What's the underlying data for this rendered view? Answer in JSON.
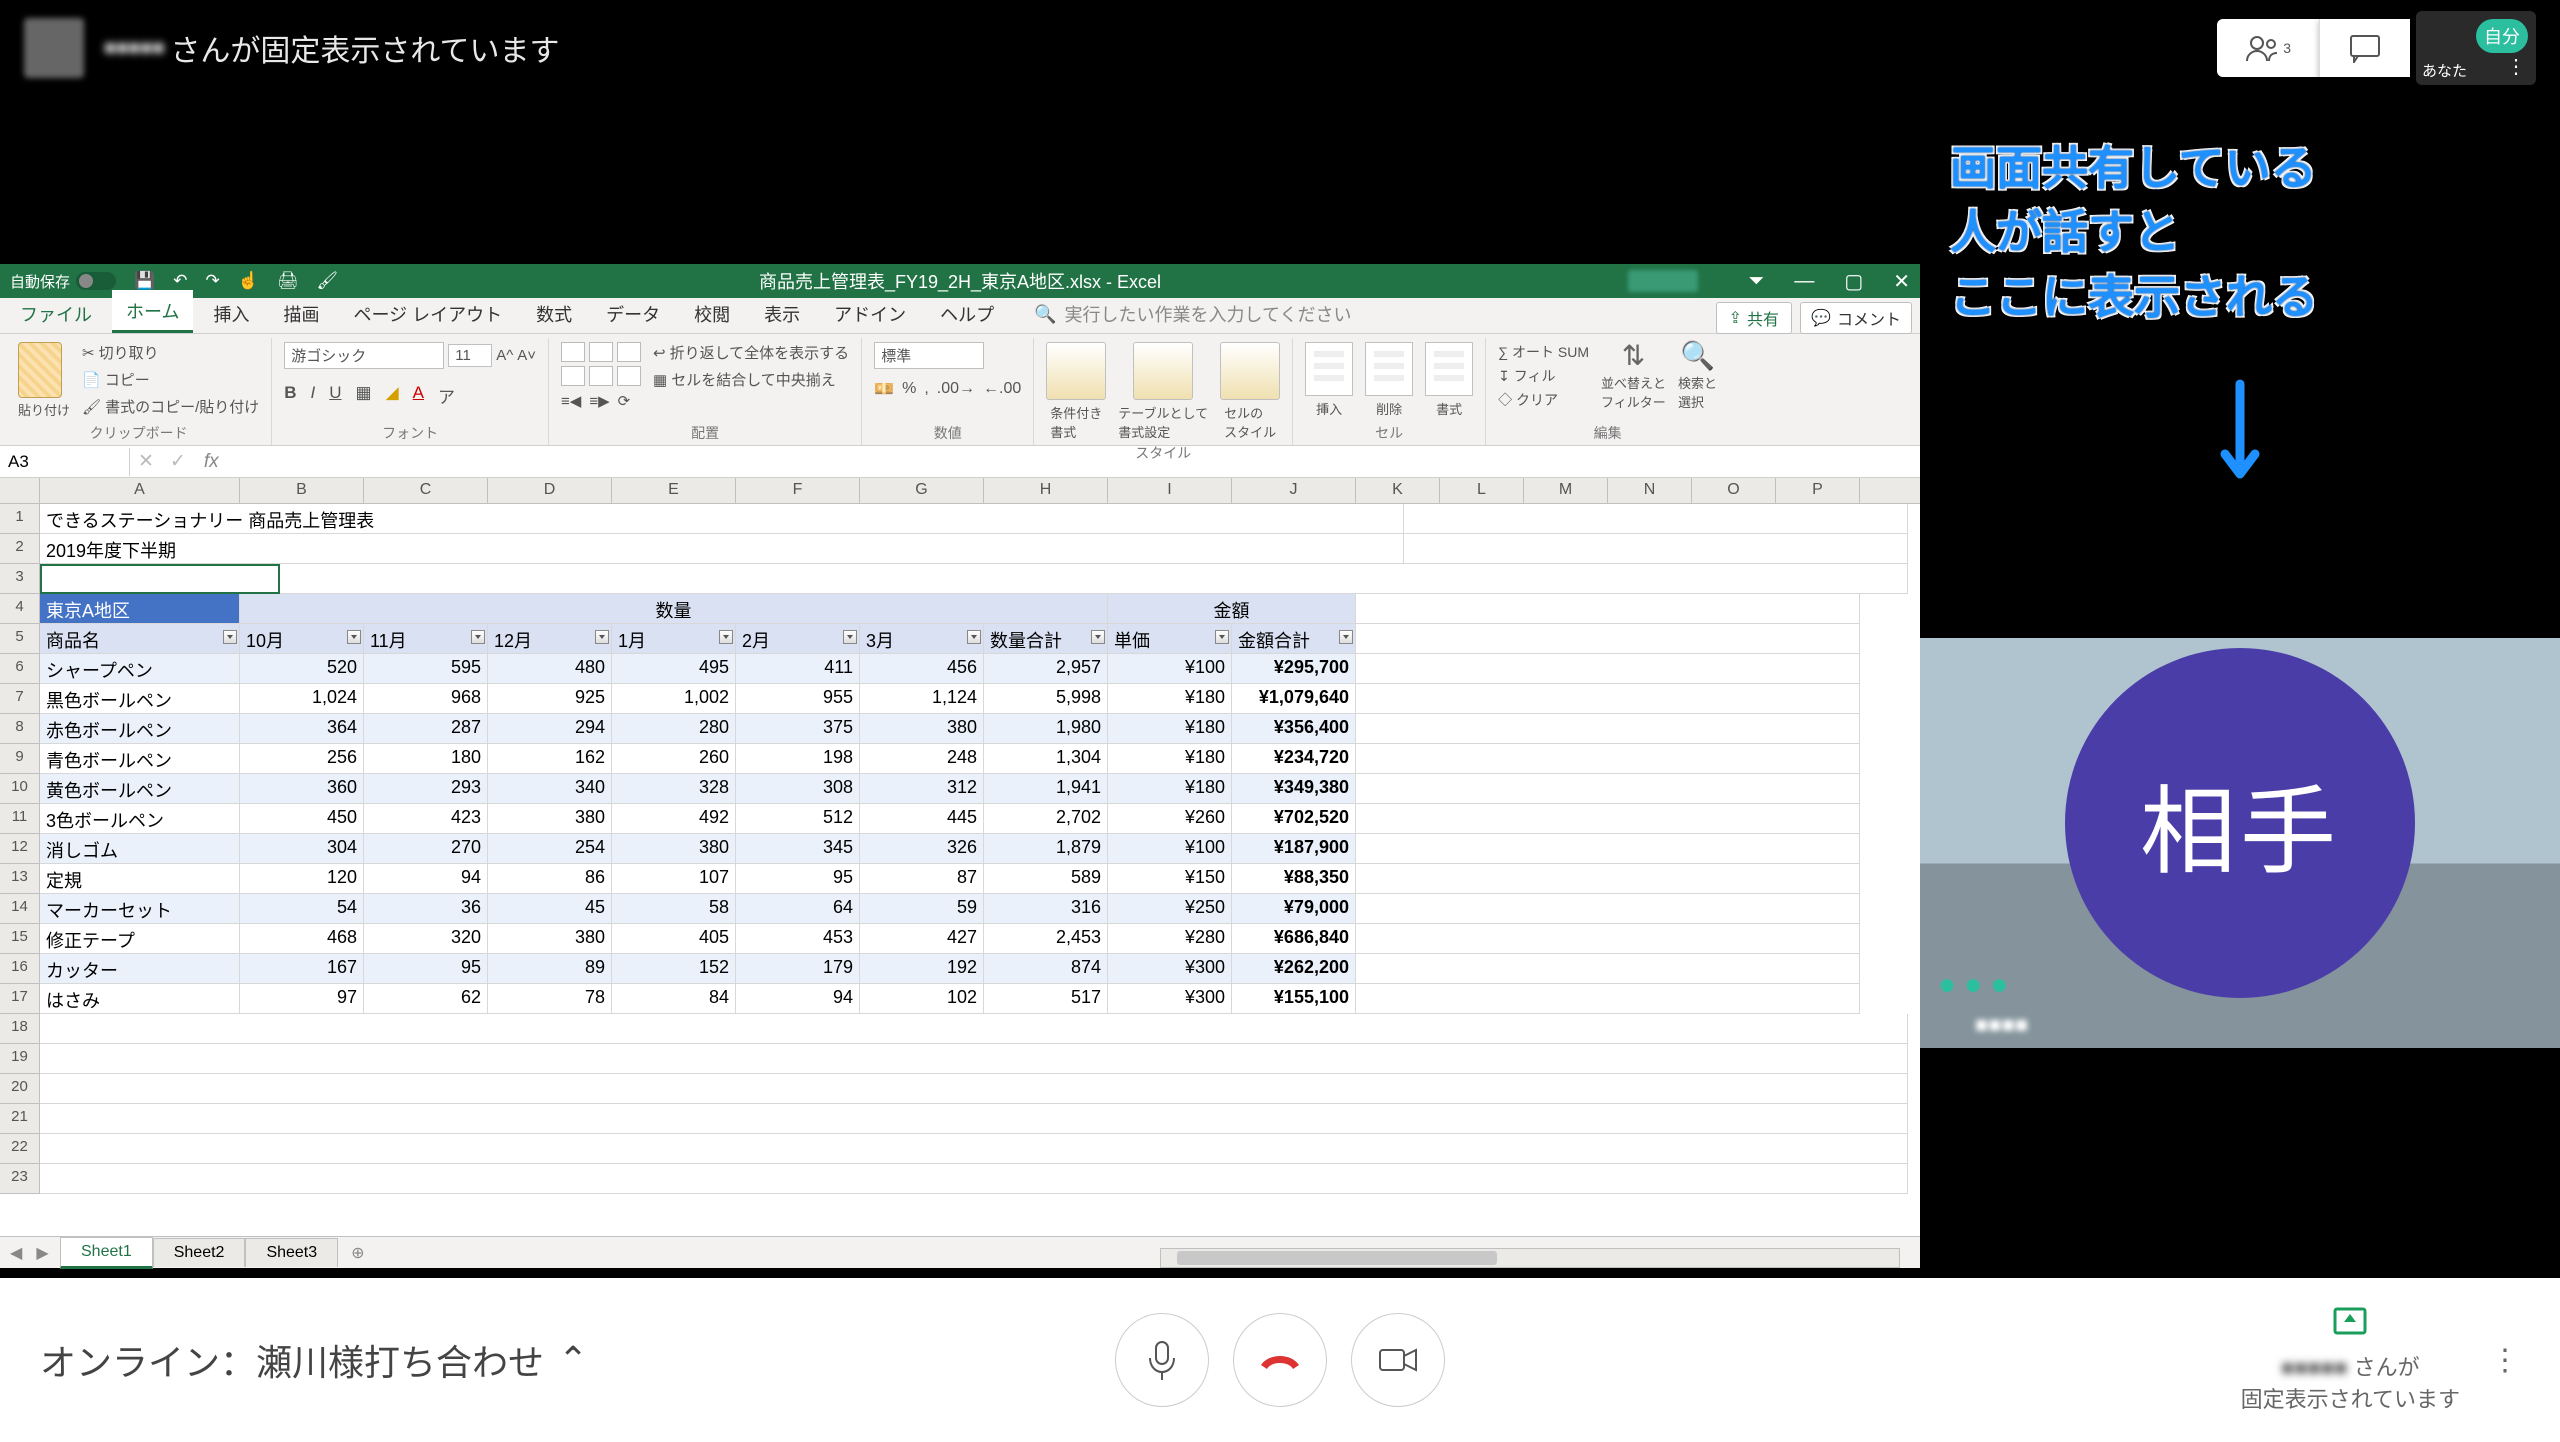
{
  "meet": {
    "topbar": {
      "presenter_name": "■■■■■",
      "pinned_text": "さんが固定表示されています",
      "people_count_badge": "3",
      "self_label": "自分",
      "you_text": "あなた"
    },
    "annotation": {
      "line1": "画面共有している",
      "line2": "人が話すと",
      "line3": "ここに表示される"
    },
    "thumbnail_circle_label": "相手",
    "bottom": {
      "meeting_name": "オンライン：瀬川様打ち合わせ",
      "pinned_name": "■■■■■",
      "pinned_suffix1": "さんが",
      "pinned_suffix2": "固定表示されています"
    }
  },
  "excel": {
    "title": "商品売上管理表_FY19_2H_東京A地区.xlsx - Excel",
    "autosave_label": "自動保存",
    "tabs": [
      "ファイル",
      "ホーム",
      "挿入",
      "描画",
      "ページ レイアウト",
      "数式",
      "データ",
      "校閲",
      "表示",
      "アドイン",
      "ヘルプ"
    ],
    "active_tab_index": 1,
    "tell_me": "実行したい作業を入力してください",
    "share_btn": "共有",
    "comment_btn": "コメント",
    "ribbon": {
      "clipboard": {
        "label": "クリップボード",
        "cut": "切り取り",
        "copy": "コピー",
        "paste_fmt": "書式のコピー/貼り付け",
        "paste": "貼り付け"
      },
      "font": {
        "label": "フォント",
        "name": "游ゴシック",
        "size": "11"
      },
      "alignment": {
        "label": "配置",
        "wrap": "折り返して全体を表示する",
        "merge": "セルを結合して中央揃え"
      },
      "number": {
        "label": "数値",
        "format": "標準"
      },
      "styles": {
        "label": "スタイル",
        "cond": "条件付き\n書式",
        "table": "テーブルとして\n書式設定",
        "cell": "セルの\nスタイル"
      },
      "cells": {
        "label": "セル",
        "insert": "挿入",
        "delete": "削除",
        "format": "書式"
      },
      "editing": {
        "label": "編集",
        "autosum": "オート SUM",
        "fill": "フィル",
        "clear": "クリア",
        "sort": "並べ替えと\nフィルター",
        "find": "検索と\n選択"
      }
    },
    "namebox": "A3",
    "cols": [
      "A",
      "B",
      "C",
      "D",
      "E",
      "F",
      "G",
      "H",
      "I",
      "J",
      "K",
      "L",
      "M",
      "N",
      "O",
      "P"
    ],
    "titles": {
      "r1": "できるステーショナリー 商品売上管理表",
      "r2": "2019年度下半期",
      "region": "東京A地区",
      "qty_header": "数量",
      "amt_header": "金額",
      "col_product": "商品名",
      "months": [
        "10月",
        "11月",
        "12月",
        "1月",
        "2月",
        "3月"
      ],
      "qty_total": "数量合計",
      "unit": "単価",
      "amt_total": "金額合計"
    },
    "rows": [
      {
        "p": "シャープペン",
        "m": [
          520,
          595,
          480,
          495,
          411,
          456
        ],
        "t": "2,957",
        "u": "¥100",
        "a": "¥295,700"
      },
      {
        "p": "黒色ボールペン",
        "m": [
          1024,
          968,
          925,
          1002,
          955,
          1124
        ],
        "t": "5,998",
        "u": "¥180",
        "a": "¥1,079,640",
        "fmt": true
      },
      {
        "p": "赤色ボールペン",
        "m": [
          364,
          287,
          294,
          280,
          375,
          380
        ],
        "t": "1,980",
        "u": "¥180",
        "a": "¥356,400"
      },
      {
        "p": "青色ボールペン",
        "m": [
          256,
          180,
          162,
          260,
          198,
          248
        ],
        "t": "1,304",
        "u": "¥180",
        "a": "¥234,720"
      },
      {
        "p": "黄色ボールペン",
        "m": [
          360,
          293,
          340,
          328,
          308,
          312
        ],
        "t": "1,941",
        "u": "¥180",
        "a": "¥349,380"
      },
      {
        "p": "3色ボールペン",
        "m": [
          450,
          423,
          380,
          492,
          512,
          445
        ],
        "t": "2,702",
        "u": "¥260",
        "a": "¥702,520"
      },
      {
        "p": "消しゴム",
        "m": [
          304,
          270,
          254,
          380,
          345,
          326
        ],
        "t": "1,879",
        "u": "¥100",
        "a": "¥187,900"
      },
      {
        "p": "定規",
        "m": [
          120,
          94,
          86,
          107,
          95,
          87
        ],
        "t": "589",
        "u": "¥150",
        "a": "¥88,350"
      },
      {
        "p": "マーカーセット",
        "m": [
          54,
          36,
          45,
          58,
          64,
          59
        ],
        "t": "316",
        "u": "¥250",
        "a": "¥79,000"
      },
      {
        "p": "修正テープ",
        "m": [
          468,
          320,
          380,
          405,
          453,
          427
        ],
        "t": "2,453",
        "u": "¥280",
        "a": "¥686,840"
      },
      {
        "p": "カッター",
        "m": [
          167,
          95,
          89,
          152,
          179,
          192
        ],
        "t": "874",
        "u": "¥300",
        "a": "¥262,200"
      },
      {
        "p": "はさみ",
        "m": [
          97,
          62,
          78,
          84,
          94,
          102
        ],
        "t": "517",
        "u": "¥300",
        "a": "¥155,100"
      }
    ],
    "sheets": [
      "Sheet1",
      "Sheet2",
      "Sheet3"
    ]
  }
}
